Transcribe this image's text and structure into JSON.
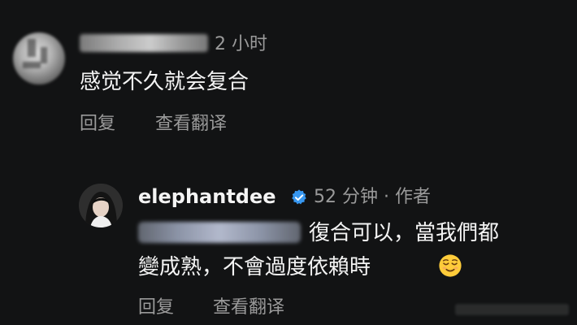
{
  "comments": [
    {
      "time": "2 小时",
      "text": "感觉不久就会复合",
      "actions": {
        "reply": "回复",
        "translate": "查看翻译"
      }
    },
    {
      "username": "elephantdee",
      "meta": "52 分钟 · 作者",
      "lines": [
        "復合可以，當我們都",
        "變成熟，不會過度依賴時"
      ],
      "actions": {
        "reply": "回复",
        "translate": "查看翻译"
      }
    }
  ]
}
